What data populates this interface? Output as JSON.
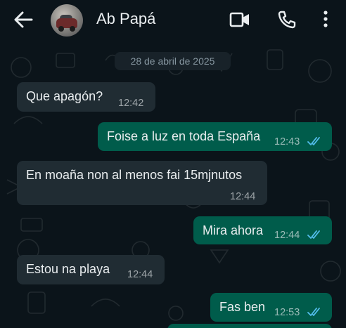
{
  "header": {
    "contact_name": "Ab Papá",
    "icons": [
      "back-arrow-icon",
      "avatar",
      "video-call-icon",
      "voice-call-icon",
      "more-options-icon"
    ]
  },
  "chat": {
    "date_chip": "28 de abril de 2025",
    "messages": [
      {
        "direction": "incoming",
        "text": "Que apagón?",
        "time": "12:42"
      },
      {
        "direction": "outgoing",
        "text": "Foise a luz en toda España",
        "time": "12:43",
        "status": "read"
      },
      {
        "direction": "incoming",
        "text": "En moaña non al menos fai 15mjnutos",
        "time": "12:44"
      },
      {
        "direction": "outgoing",
        "text": "Mira ahora",
        "time": "12:44",
        "status": "read"
      },
      {
        "direction": "incoming",
        "text": "Estou na playa",
        "time": "12:44"
      },
      {
        "direction": "outgoing",
        "text": "Fas ben",
        "time": "12:53",
        "status": "read"
      }
    ]
  },
  "colors": {
    "background": "#0b141a",
    "incoming_bubble": "#202c33",
    "outgoing_bubble": "#005c4b",
    "read_ticks": "#53bdeb",
    "text": "#e9edef"
  }
}
